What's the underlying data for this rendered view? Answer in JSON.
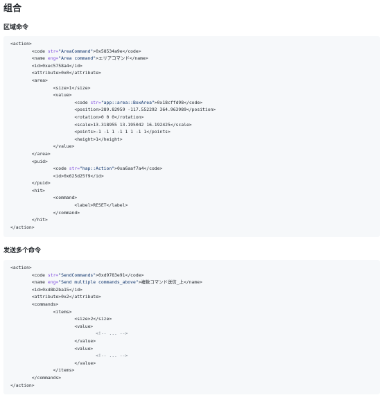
{
  "title": "组合",
  "sections": [
    {
      "heading": "区域命令",
      "lines": [
        {
          "indent": 0,
          "t": "tag",
          "text": "<action>"
        },
        {
          "indent": 1,
          "t": "attr",
          "tag": "code",
          "attr": "str",
          "val": "\"AreaCommand\"",
          "text": "0x58534a9e"
        },
        {
          "indent": 1,
          "t": "attr",
          "tag": "name",
          "attr": "eng",
          "val": "\"Area command\"",
          "text": "エリアコマンド"
        },
        {
          "indent": 1,
          "t": "simple",
          "tag": "id",
          "text": "0xec5758a4"
        },
        {
          "indent": 1,
          "t": "simple",
          "tag": "attribute",
          "text": "0x0"
        },
        {
          "indent": 1,
          "t": "tag",
          "text": "<area>"
        },
        {
          "indent": 2,
          "t": "simple",
          "tag": "size",
          "text": "1"
        },
        {
          "indent": 2,
          "t": "tag",
          "text": "<value>"
        },
        {
          "indent": 3,
          "t": "attr",
          "tag": "code",
          "attr": "str",
          "val": "\"app::area::BoxArea\"",
          "text": "0x18cffd98"
        },
        {
          "indent": 3,
          "t": "simple",
          "tag": "position",
          "text": "289.82959 -117.552292 364.963989"
        },
        {
          "indent": 3,
          "t": "simple",
          "tag": "rotation",
          "text": "0 0 0"
        },
        {
          "indent": 3,
          "t": "simple",
          "tag": "scale",
          "text": "13.318955 13.195042 16.192425"
        },
        {
          "indent": 3,
          "t": "simple",
          "tag": "points",
          "text": "-1 -1 1 -1 1 1 -1 1"
        },
        {
          "indent": 3,
          "t": "simple",
          "tag": "height",
          "text": "1"
        },
        {
          "indent": 2,
          "t": "tag",
          "text": "</value>"
        },
        {
          "indent": 1,
          "t": "tag",
          "text": "</area>"
        },
        {
          "indent": 1,
          "t": "tag",
          "text": "<puid>"
        },
        {
          "indent": 2,
          "t": "attr",
          "tag": "code",
          "attr": "str",
          "val": "\"hap::Action\"",
          "text": "0xa6aaf7a4"
        },
        {
          "indent": 2,
          "t": "simple",
          "tag": "id",
          "text": "0x625d25f9"
        },
        {
          "indent": 1,
          "t": "tag",
          "text": "</puid>"
        },
        {
          "indent": 1,
          "t": "tag",
          "text": "<hit>"
        },
        {
          "indent": 2,
          "t": "tag",
          "text": "<command>"
        },
        {
          "indent": 3,
          "t": "simple",
          "tag": "label",
          "text": "RESET"
        },
        {
          "indent": 2,
          "t": "tag",
          "text": "</command>"
        },
        {
          "indent": 1,
          "t": "tag",
          "text": "</hit>"
        },
        {
          "indent": 0,
          "t": "tag",
          "text": "</action>"
        }
      ]
    },
    {
      "heading": "发送多个命令",
      "lines": [
        {
          "indent": 0,
          "t": "tag",
          "text": "<action>"
        },
        {
          "indent": 1,
          "t": "attr",
          "tag": "code",
          "attr": "str",
          "val": "\"SendCommands\"",
          "text": "0xd9783e91"
        },
        {
          "indent": 1,
          "t": "attr",
          "tag": "name",
          "attr": "eng",
          "val": "\"Send multiple commands_above\"",
          "text": "複数コマンド送信_上"
        },
        {
          "indent": 1,
          "t": "simple",
          "tag": "id",
          "text": "0xd8b2ba15"
        },
        {
          "indent": 1,
          "t": "simple",
          "tag": "attribute",
          "text": "0x2"
        },
        {
          "indent": 1,
          "t": "tag",
          "text": "<commands>"
        },
        {
          "indent": 2,
          "t": "tag",
          "text": "<items>"
        },
        {
          "indent": 3,
          "t": "simple",
          "tag": "size",
          "text": "2"
        },
        {
          "indent": 3,
          "t": "tag",
          "text": "<value>"
        },
        {
          "indent": 4,
          "t": "comment",
          "text": "<!-- ... -->"
        },
        {
          "indent": 3,
          "t": "tag",
          "text": "</value>"
        },
        {
          "indent": 3,
          "t": "tag",
          "text": "<value>"
        },
        {
          "indent": 4,
          "t": "comment",
          "text": "<!-- ... -->"
        },
        {
          "indent": 3,
          "t": "tag",
          "text": "</value>"
        },
        {
          "indent": 2,
          "t": "tag",
          "text": "</items>"
        },
        {
          "indent": 1,
          "t": "tag",
          "text": "</commands>"
        },
        {
          "indent": 0,
          "t": "tag",
          "text": "</action>"
        }
      ]
    }
  ]
}
